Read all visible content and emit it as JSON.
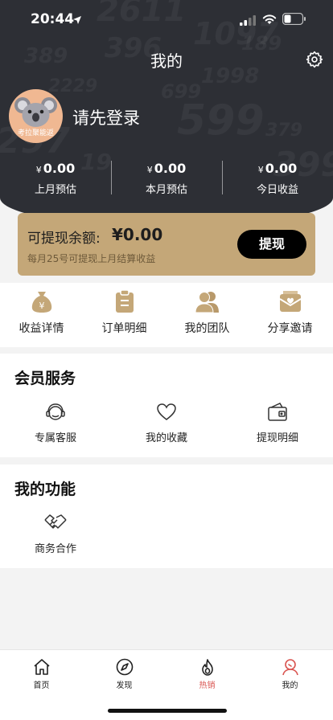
{
  "status_bar": {
    "time": "20:44"
  },
  "header": {
    "title": "我的"
  },
  "profile": {
    "avatar_text": "考拉聚能返",
    "login_prompt": "请先登录"
  },
  "stats": [
    {
      "currency": "¥",
      "value": "0.00",
      "label": "上月预估"
    },
    {
      "currency": "¥",
      "value": "0.00",
      "label": "本月预估"
    },
    {
      "currency": "¥",
      "value": "0.00",
      "label": "今日收益"
    }
  ],
  "balance": {
    "label": "可提现余额:",
    "amount": "¥0.00",
    "note": "每月25号可提现上月结算收益",
    "withdraw_label": "提现"
  },
  "quick_actions": [
    {
      "label": "收益详情",
      "icon": "money-bag-icon"
    },
    {
      "label": "订单明细",
      "icon": "clipboard-icon"
    },
    {
      "label": "我的团队",
      "icon": "team-icon"
    },
    {
      "label": "分享邀请",
      "icon": "envelope-icon"
    }
  ],
  "member_services": {
    "title": "会员服务",
    "items": [
      {
        "label": "专属客服",
        "icon": "headset-icon"
      },
      {
        "label": "我的收藏",
        "icon": "heart-icon"
      },
      {
        "label": "提现明细",
        "icon": "wallet-icon"
      }
    ]
  },
  "my_functions": {
    "title": "我的功能",
    "items": [
      {
        "label": "商务合作",
        "icon": "handshake-icon"
      }
    ]
  },
  "tabbar": {
    "items": [
      {
        "label": "首页",
        "icon": "home-icon"
      },
      {
        "label": "发现",
        "icon": "compass-icon"
      },
      {
        "label": "热销",
        "icon": "flame-icon"
      },
      {
        "label": "我的",
        "icon": "user-icon"
      }
    ]
  },
  "colors": {
    "header_bg": "#2d2f35",
    "gold": "#c4a778",
    "accent_red": "#d9534f"
  }
}
